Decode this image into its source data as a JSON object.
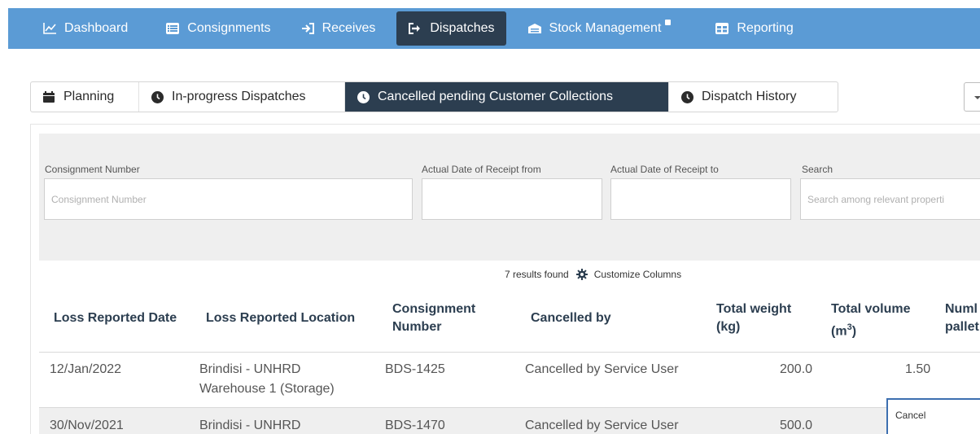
{
  "nav": {
    "items": [
      {
        "label": "Dashboard",
        "icon": "chart-line-icon"
      },
      {
        "label": "Consignments",
        "icon": "list-icon"
      },
      {
        "label": "Receives",
        "icon": "sign-in-icon"
      },
      {
        "label": "Dispatches",
        "icon": "sign-out-icon"
      },
      {
        "label": "Stock Management",
        "icon": "warehouse-icon"
      },
      {
        "label": "Reporting",
        "icon": "table-icon"
      }
    ],
    "active": "Dispatches",
    "color": "#5b9bd5",
    "active_color": "#2c3e50"
  },
  "subtabs": {
    "items": [
      {
        "label": "Planning",
        "icon": "calendar-icon"
      },
      {
        "label": "In-progress Dispatches",
        "icon": "clock-icon"
      },
      {
        "label": "Cancelled pending Customer Collections",
        "icon": "clock-icon"
      },
      {
        "label": "Dispatch History",
        "icon": "clock-icon"
      }
    ],
    "active": "Cancelled pending Customer Collections"
  },
  "filters": {
    "consignment_number": {
      "label": "Consignment Number",
      "placeholder": "Consignment Number",
      "value": ""
    },
    "date_from": {
      "label": "Actual Date of Receipt from",
      "value": ""
    },
    "date_to": {
      "label": "Actual Date of Receipt to",
      "value": ""
    },
    "search": {
      "label": "Search",
      "placeholder": "Search among relevant properti"
    }
  },
  "results": {
    "count_text": "7 results found",
    "customize_label": "Customize Columns"
  },
  "table": {
    "columns": [
      {
        "line1": "Loss Reported Date",
        "line2": ""
      },
      {
        "line1": "Loss Reported Location",
        "line2": ""
      },
      {
        "line1": "Consignment",
        "line2": "Number"
      },
      {
        "line1": "Cancelled by",
        "line2": ""
      },
      {
        "line1": "Total weight",
        "line2": "(kg)"
      },
      {
        "line1": "Total volume",
        "line2": "(m",
        "sup": "3",
        "close": ")"
      },
      {
        "line1": "Numl",
        "line2": "pallet"
      }
    ],
    "rows": [
      {
        "date": "12/Jan/2022",
        "location_line1": "Brindisi - UNHRD",
        "location_line2": "Warehouse 1 (Storage)",
        "consignment": "BDS-1425",
        "cancelled_by": "Cancelled by Service User",
        "weight": "200.0",
        "volume": "1.50"
      },
      {
        "date": "30/Nov/2021",
        "location_line1": "Brindisi - UNHRD",
        "location_line2": "",
        "consignment": "BDS-1470",
        "cancelled_by": "Cancelled by Service User",
        "weight": "500.0",
        "volume": ""
      }
    ]
  },
  "popup": {
    "label": "Cancel"
  }
}
